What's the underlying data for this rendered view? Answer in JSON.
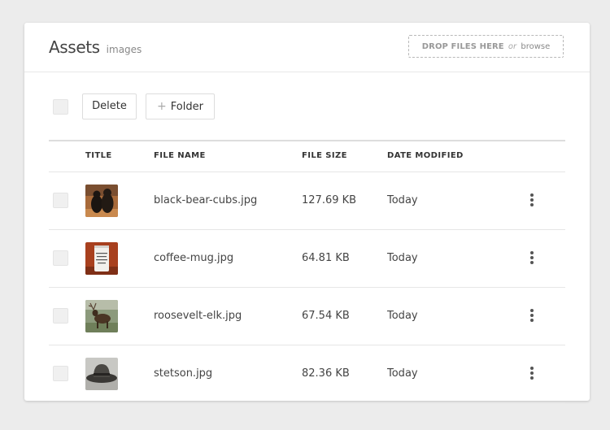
{
  "header": {
    "title": "Assets",
    "subtitle": "images",
    "dropzone": {
      "strong": "DROP FILES HERE",
      "or": "or",
      "browse": "browse"
    }
  },
  "toolbar": {
    "delete_label": "Delete",
    "folder_label": "Folder"
  },
  "table": {
    "columns": [
      "TITLE",
      "FILE NAME",
      "FILE SIZE",
      "DATE MODIFIED"
    ],
    "rows": [
      {
        "file_name": "black-bear-cubs.jpg",
        "file_size": "127.69 KB",
        "date_modified": "Today"
      },
      {
        "file_name": "coffee-mug.jpg",
        "file_size": "64.81 KB",
        "date_modified": "Today"
      },
      {
        "file_name": "roosevelt-elk.jpg",
        "file_size": "67.54 KB",
        "date_modified": "Today"
      },
      {
        "file_name": "stetson.jpg",
        "file_size": "82.36 KB",
        "date_modified": "Today"
      }
    ]
  },
  "thumb_icons": [
    "black-bear-cubs-thumbnail",
    "coffee-mug-thumbnail",
    "roosevelt-elk-thumbnail",
    "stetson-thumbnail"
  ]
}
